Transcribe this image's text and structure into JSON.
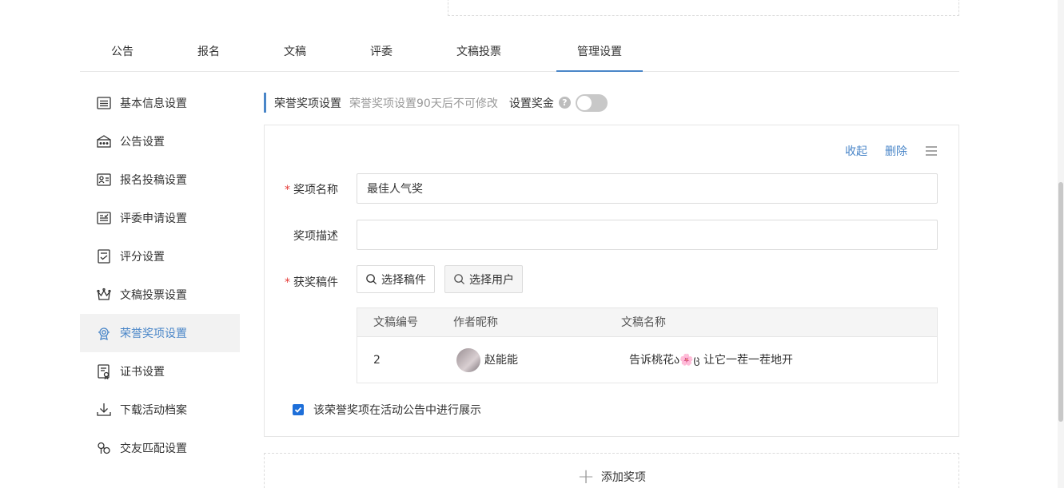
{
  "tabs": [
    {
      "label": "公告"
    },
    {
      "label": "报名"
    },
    {
      "label": "文稿"
    },
    {
      "label": "评委"
    },
    {
      "label": "文稿投票"
    },
    {
      "label": "管理设置"
    }
  ],
  "active_tab": "管理设置",
  "sidebar": {
    "items": [
      {
        "label": "基本信息设置",
        "icon": "list-icon"
      },
      {
        "label": "公告设置",
        "icon": "notice-icon"
      },
      {
        "label": "报名投稿设置",
        "icon": "id-card-icon"
      },
      {
        "label": "评委申请设置",
        "icon": "form-icon"
      },
      {
        "label": "评分设置",
        "icon": "checklist-icon"
      },
      {
        "label": "文稿投票设置",
        "icon": "crown-icon"
      },
      {
        "label": "荣誉奖项设置",
        "icon": "medal-icon"
      },
      {
        "label": "证书设置",
        "icon": "certificate-icon"
      },
      {
        "label": "下载活动档案",
        "icon": "download-icon"
      },
      {
        "label": "交友匹配设置",
        "icon": "match-icon"
      }
    ],
    "active": "荣誉奖项设置"
  },
  "section": {
    "title": "荣誉奖项设置",
    "hint": "荣誉奖项设置90天后不可修改",
    "bonus_label": "设置奖金",
    "help_glyph": "?",
    "bonus_enabled": false
  },
  "award": {
    "actions": {
      "collapse": "收起",
      "delete": "删除"
    },
    "name_label": "奖项名称",
    "name_value": "最佳人气奖",
    "desc_label": "奖项描述",
    "desc_value": "",
    "works_label": "获奖稿件",
    "select_work": "选择稿件",
    "select_user": "选择用户",
    "table": {
      "headers": [
        "文稿编号",
        "作者昵称",
        "文稿名称"
      ],
      "rows": [
        {
          "id": "2",
          "author": "赵能能",
          "title": "告诉桃花ა🌸ც 让它一茬一茬地开"
        }
      ]
    },
    "show_in_notice_label": "该荣誉奖项在活动公告中进行展示",
    "show_in_notice": true
  },
  "add_award": {
    "plus": "+",
    "label": "添加奖项"
  },
  "colors": {
    "accent": "#4a86c8",
    "required": "#e53935",
    "checkbox": "#1e6fd9"
  }
}
